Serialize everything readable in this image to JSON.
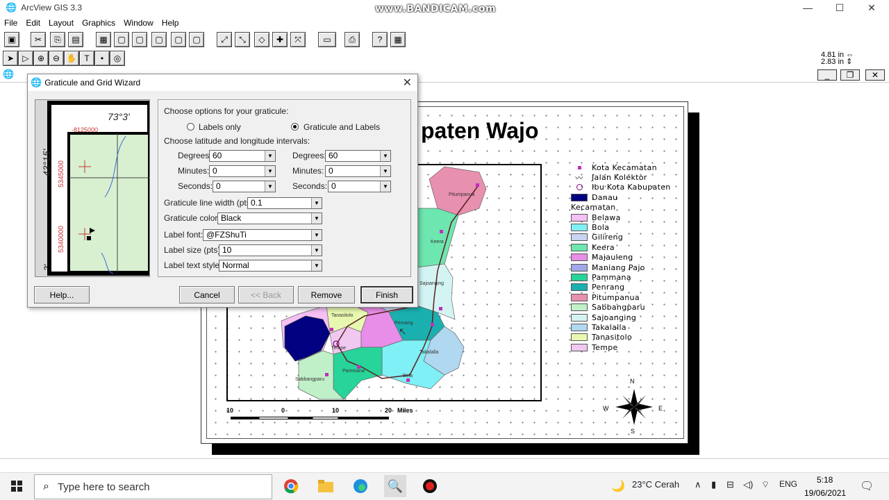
{
  "window": {
    "title": "ArcView GIS 3.3",
    "watermark": "www.BANDICAM.com"
  },
  "menu": [
    "File",
    "Edit",
    "Layout",
    "Graphics",
    "Window",
    "Help"
  ],
  "coords": {
    "x": "4.81 in",
    "y": "2.83 in"
  },
  "layout_doc": {
    "title_visible": "paten Wajo"
  },
  "legend": {
    "items": [
      {
        "label": "Kota Kecamatan",
        "symbol": "point",
        "color": "#c030c0"
      },
      {
        "label": "Jalan Kolektor",
        "symbol": "line",
        "color": "#000000"
      },
      {
        "label": "Ibu Kota Kabupaten",
        "symbol": "capital",
        "color": "#800080"
      },
      {
        "label": "Danau",
        "symbol": "fill",
        "color": "#000080"
      }
    ],
    "group_label": "Kecamatan",
    "kecamatan": [
      {
        "label": "Belawa",
        "color": "#f5c0f5"
      },
      {
        "label": "Bola",
        "color": "#7ff0f5"
      },
      {
        "label": "Gilireng",
        "color": "#c8d4f0"
      },
      {
        "label": "Keera",
        "color": "#6ee6b0"
      },
      {
        "label": "Majauleng",
        "color": "#e88ee8"
      },
      {
        "label": "Maniang Pajo",
        "color": "#a0a8e8"
      },
      {
        "label": "Pammana",
        "color": "#28d49a"
      },
      {
        "label": "Penrang",
        "color": "#1ab0b0"
      },
      {
        "label": "Pitumpanua",
        "color": "#e890b0"
      },
      {
        "label": "Sabbangparu",
        "color": "#c0f0c8"
      },
      {
        "label": "Sajoanging",
        "color": "#d4f4f4"
      },
      {
        "label": "Takalalla",
        "color": "#b0d8f0"
      },
      {
        "label": "Tanasitolo",
        "color": "#e8f8b0"
      },
      {
        "label": "Tempe",
        "color": "#f0c8f0"
      }
    ]
  },
  "scale": {
    "ticks": [
      "10",
      "0",
      "10",
      "20"
    ],
    "unit": "Miles"
  },
  "compass": {
    "n": "N",
    "s": "S",
    "e": "E",
    "w": "W"
  },
  "map_labels": [
    "Pitumpanua",
    "Keera",
    "Sajoanging",
    "Tanasitolo",
    "Penrang",
    "Tempe",
    "Takalalla",
    "Pammana",
    "Sabbangparu",
    "Bola"
  ],
  "dialog": {
    "title": "Graticule and Grid Wizard",
    "preview": {
      "lon": "73°3'",
      "x_tick": "-8125000",
      "lat": "43°15'",
      "y1": "5345000",
      "y2": "5340000",
      "lat2": "2'"
    },
    "heading": "Choose options for your graticule:",
    "radio_labels_only": "Labels only",
    "radio_graticule_labels": "Graticule and Labels",
    "interval_heading": "Choose latitude and longitude intervals:",
    "lat": {
      "degrees_label": "Degrees:",
      "degrees": "60",
      "minutes_label": "Minutes:",
      "minutes": "0",
      "seconds_label": "Seconds:",
      "seconds": "0"
    },
    "lon": {
      "degrees_label": "Degrees:",
      "degrees": "60",
      "minutes_label": "Minutes:",
      "minutes": "0",
      "seconds_label": "Seconds:",
      "seconds": "0"
    },
    "line_width_label": "Graticule line width (pts):",
    "line_width": "0.1",
    "color_label": "Graticule color:",
    "color": "Black",
    "font_label": "Label font:",
    "font": "@FZShuTi",
    "size_label": "Label size (pts):",
    "size": "10",
    "style_label": "Label text style:",
    "style": "Normal",
    "buttons": {
      "help": "Help...",
      "cancel": "Cancel",
      "back": "<< Back",
      "remove": "Remove",
      "finish": "Finish"
    }
  },
  "taskbar": {
    "search_placeholder": "Type here to search",
    "weather": "23°C Cerah",
    "lang": "ENG",
    "time": "5:18",
    "date": "19/06/2021"
  }
}
